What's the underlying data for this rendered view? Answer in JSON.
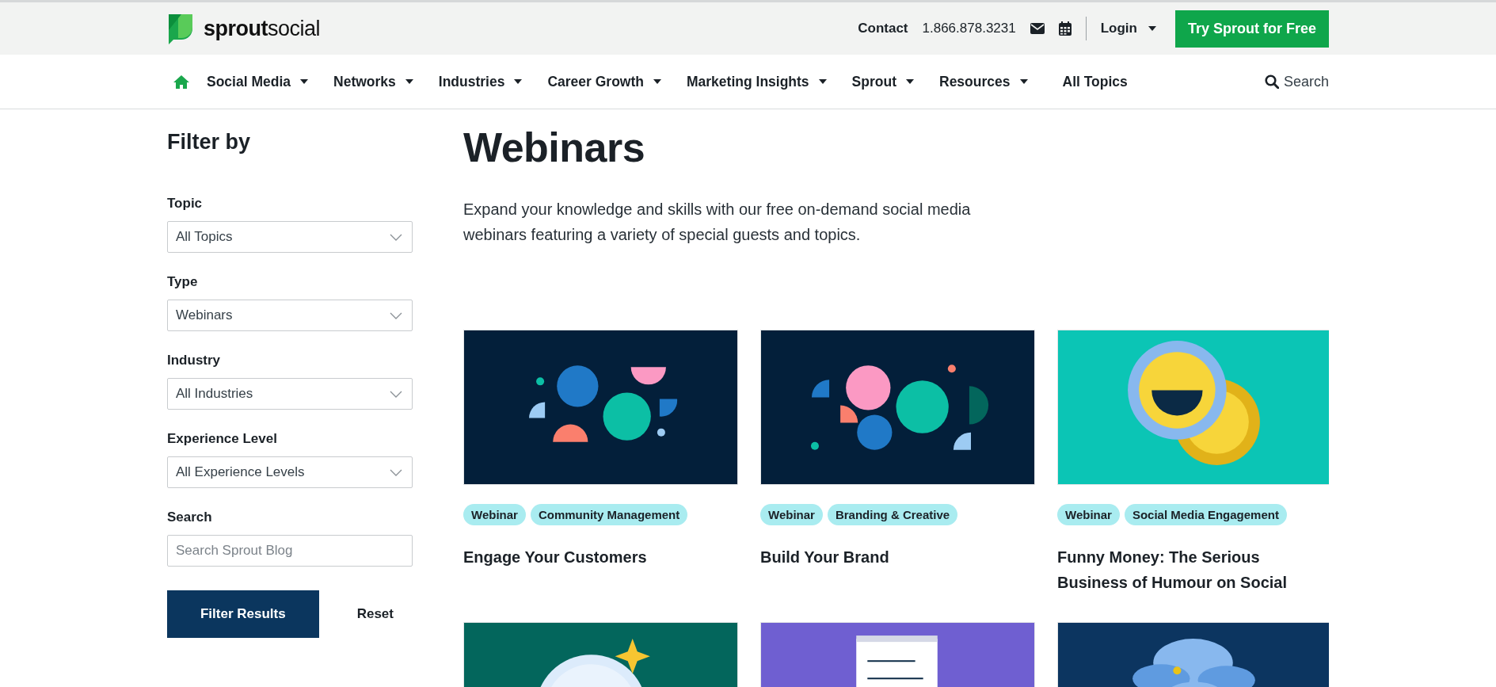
{
  "header": {
    "logo": {
      "bold": "sprout",
      "light": "social"
    },
    "contact": "Contact",
    "phone": "1.866.878.3231",
    "login": "Login",
    "cta": "Try Sprout for Free"
  },
  "nav": {
    "items": [
      {
        "label": "Social Media",
        "dropdown": true
      },
      {
        "label": "Networks",
        "dropdown": true
      },
      {
        "label": "Industries",
        "dropdown": true
      },
      {
        "label": "Career Growth",
        "dropdown": true
      },
      {
        "label": "Marketing Insights",
        "dropdown": true
      },
      {
        "label": "Sprout",
        "dropdown": true
      },
      {
        "label": "Resources",
        "dropdown": true
      },
      {
        "label": "All Topics",
        "dropdown": false
      }
    ],
    "search": "Search"
  },
  "sidebar": {
    "title": "Filter by",
    "filters": [
      {
        "kind": "select",
        "label": "Topic",
        "value": "All Topics"
      },
      {
        "kind": "select",
        "label": "Type",
        "value": "Webinars"
      },
      {
        "kind": "select",
        "label": "Industry",
        "value": "All Industries"
      },
      {
        "kind": "select",
        "label": "Experience Level",
        "value": "All Experience Levels"
      },
      {
        "kind": "search",
        "label": "Search",
        "placeholder": "Search Sprout Blog"
      }
    ],
    "submit": "Filter Results",
    "reset": "Reset"
  },
  "main": {
    "title": "Webinars",
    "intro": "Expand your knowledge and skills with our free on-demand social media webinars featuring a variety of special guests and topics.",
    "cards": [
      {
        "image": {
          "kind": "picture"
        },
        "tags": [
          "Webinar",
          "Community Management"
        ],
        "title": "Engage Your Customers"
      },
      {
        "image": {
          "kind": "picture"
        },
        "tags": [
          "Webinar",
          "Branding & Creative"
        ],
        "title": "Build Your Brand"
      },
      {
        "image": {
          "kind": "picture"
        },
        "tags": [
          "Webinar",
          "Social Media Engagement"
        ],
        "title": "Funny Money: The Serious Business of Humour on Social"
      },
      {
        "image": {
          "kind": "picture"
        }
      },
      {
        "image": {
          "kind": "picture"
        }
      },
      {
        "image": {
          "kind": "picture"
        }
      }
    ]
  }
}
